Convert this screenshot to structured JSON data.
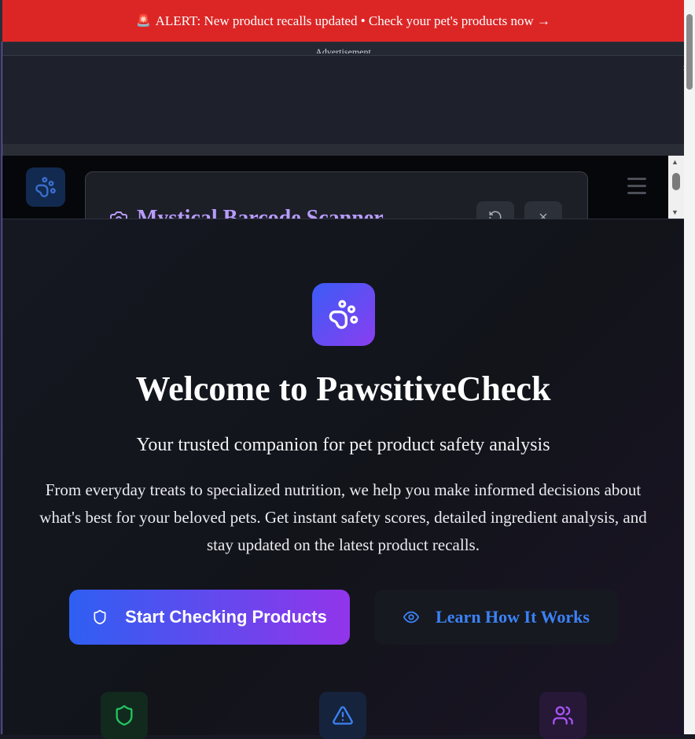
{
  "alert": {
    "icon": "siren-icon",
    "text": "ALERT: New product recalls updated • Check your pet's products now →"
  },
  "ad": {
    "label": "Advertisement",
    "close": "×"
  },
  "iframe": {
    "scanner_title": "Mystical Barcode Scanner"
  },
  "hero": {
    "title": "Welcome to PawsitiveCheck",
    "subtitle": "Your trusted companion for pet product safety analysis",
    "description": "From everyday treats to specialized nutrition, we help you make informed decisions about what's best for your beloved pets. Get instant safety scores, detailed ingredient analysis, and stay updated on the latest product recalls.",
    "primary_button": "Start Checking Products",
    "secondary_button": "Learn How It Works"
  },
  "features": [
    {
      "icon": "shield-icon",
      "color": "#22c55e"
    },
    {
      "icon": "warning-icon",
      "color": "#3b82f6"
    },
    {
      "icon": "users-icon",
      "color": "#a855f7"
    }
  ],
  "colors": {
    "alert": "#dc2626",
    "accent_blue": "#3b82f6",
    "accent_purple": "#9235ea"
  }
}
